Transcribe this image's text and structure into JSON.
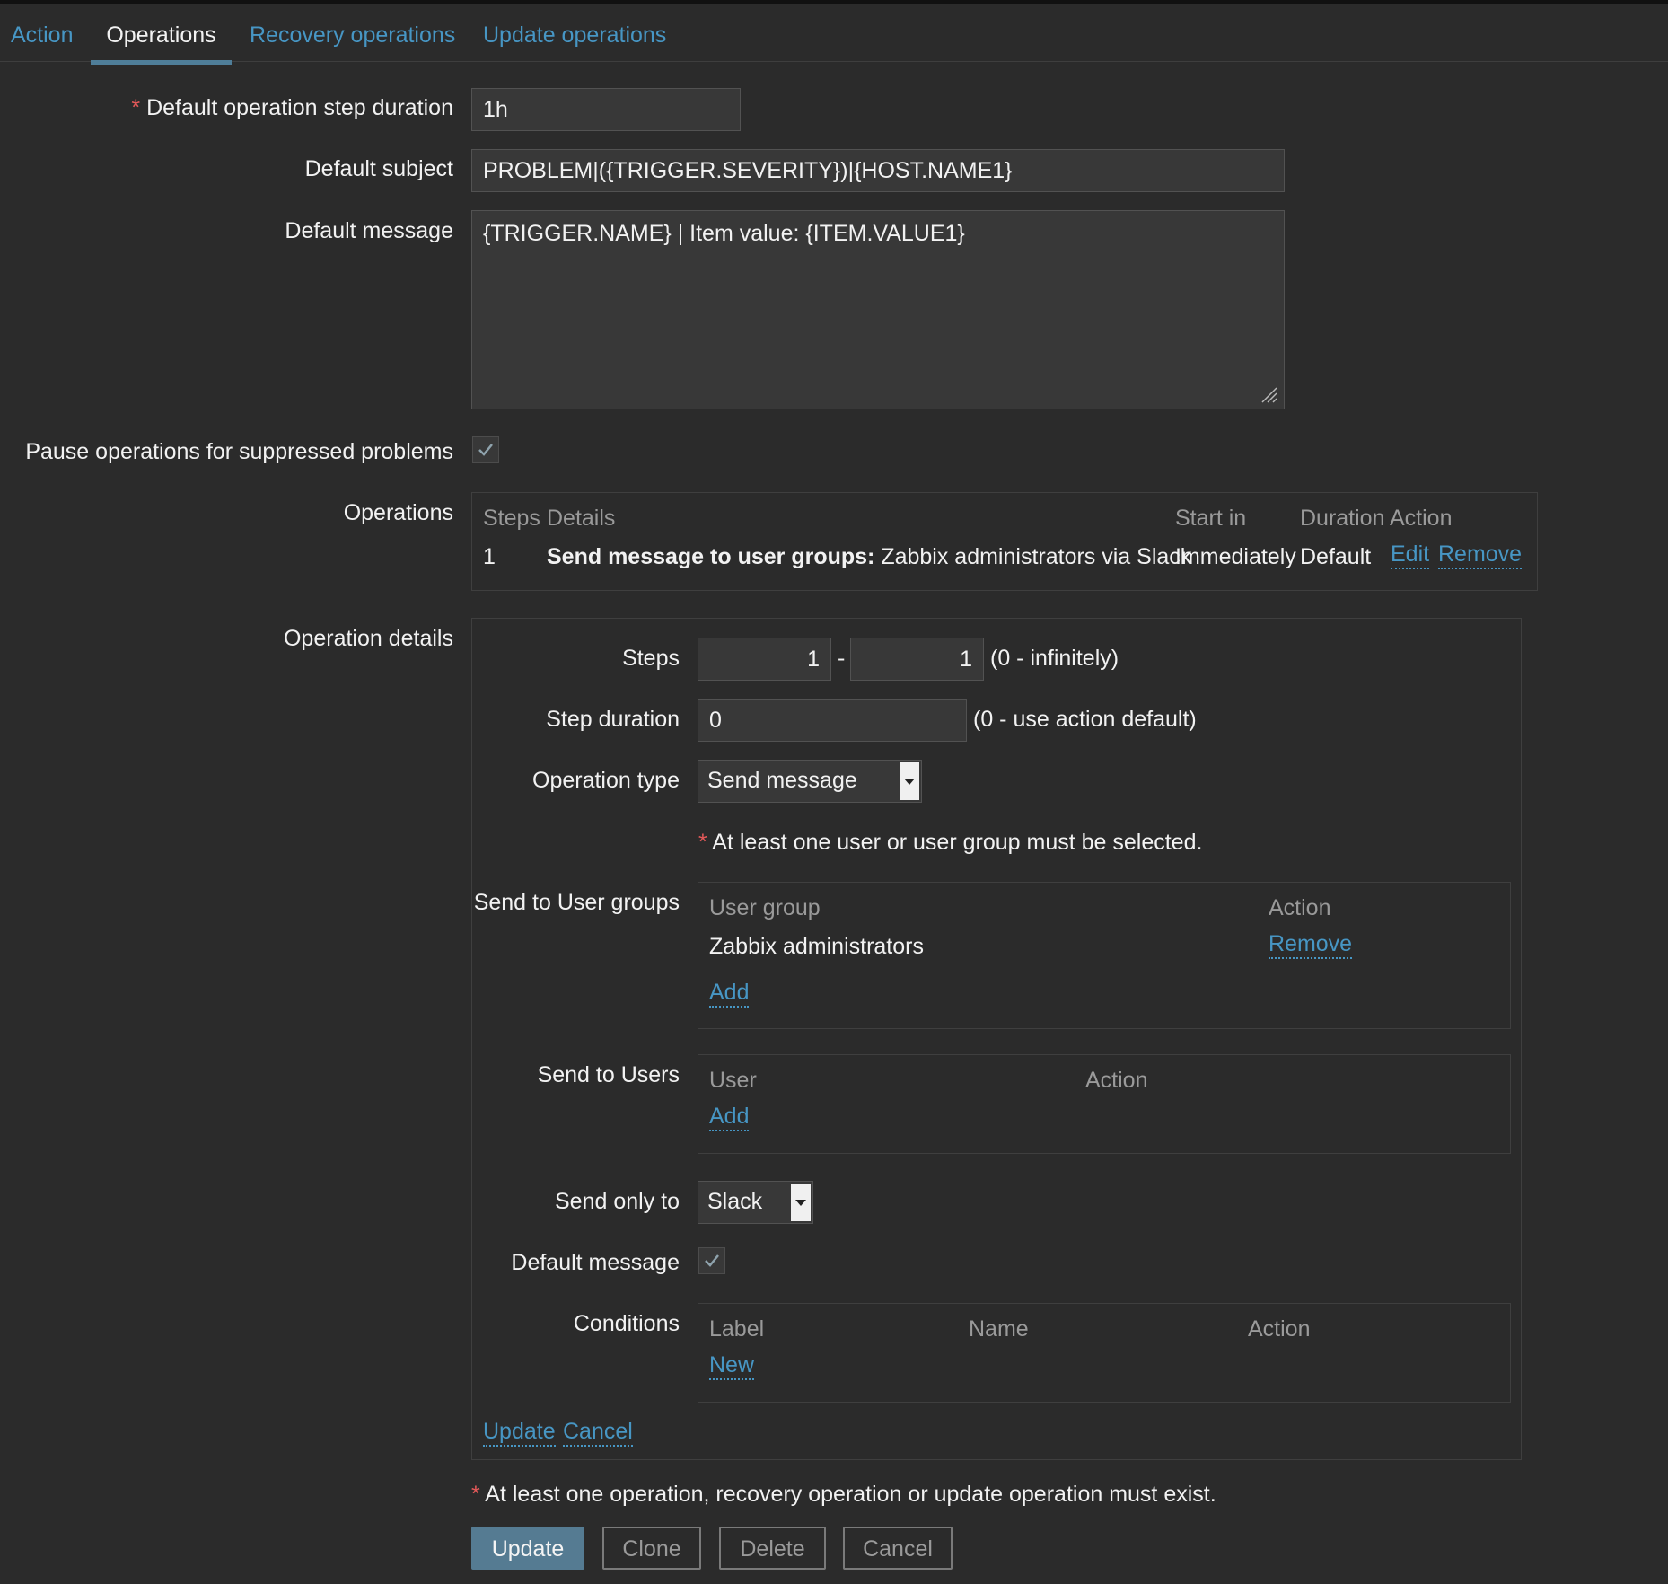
{
  "tabs": [
    "Action",
    "Operations",
    "Recovery operations",
    "Update operations"
  ],
  "form": {
    "step_duration_label": "Default operation step duration",
    "step_duration_value": "1h",
    "subject_label": "Default subject",
    "subject_value": "PROBLEM|({TRIGGER.SEVERITY})|{HOST.NAME1}",
    "message_label": "Default message",
    "message_value": "{TRIGGER.NAME} | Item value: {ITEM.VALUE1}",
    "pause_label": "Pause operations for suppressed problems",
    "pause_checked": true,
    "operations_label": "Operations"
  },
  "operations_table": {
    "headers": [
      "Steps",
      "Details",
      "Start in",
      "Duration",
      "Action"
    ],
    "rows": [
      {
        "steps": "1",
        "details_bold": "Send message to user groups:",
        "details_rest": " Zabbix administrators via Slack",
        "start_in": "Immediately",
        "duration": "Default",
        "actions": [
          "Edit",
          "Remove"
        ]
      }
    ]
  },
  "operation_details": {
    "label": "Operation details",
    "steps_label": "Steps",
    "step_from": "1",
    "step_sep": "-",
    "step_to": "1",
    "steps_hint": "(0 - infinitely)",
    "step_duration_label": "Step duration",
    "step_duration_value": "0",
    "step_duration_hint": "(0 - use action default)",
    "op_type_label": "Operation type",
    "op_type_value": "Send message",
    "user_note": "At least one user or user group must be selected.",
    "user_groups_label": "Send to User groups",
    "user_groups_headers": [
      "User group",
      "Action"
    ],
    "user_groups_rows": [
      {
        "name": "Zabbix administrators",
        "action": "Remove"
      }
    ],
    "user_groups_add": "Add",
    "users_label": "Send to Users",
    "users_headers": [
      "User",
      "Action"
    ],
    "users_add": "Add",
    "send_only_label": "Send only to",
    "send_only_value": "Slack",
    "default_message_label": "Default message",
    "default_message_checked": true,
    "conditions_label": "Conditions",
    "conditions_headers": [
      "Label",
      "Name",
      "Action"
    ],
    "conditions_new": "New",
    "update_link": "Update",
    "cancel_link": "Cancel"
  },
  "footer": {
    "note": "At least one operation, recovery operation or update operation must exist.",
    "buttons": [
      "Update",
      "Clone",
      "Delete",
      "Cancel"
    ]
  },
  "colors": {
    "background": "#2b2b2b",
    "link": "#4796c4",
    "required": "#e45959",
    "primary_button": "#557b92"
  }
}
